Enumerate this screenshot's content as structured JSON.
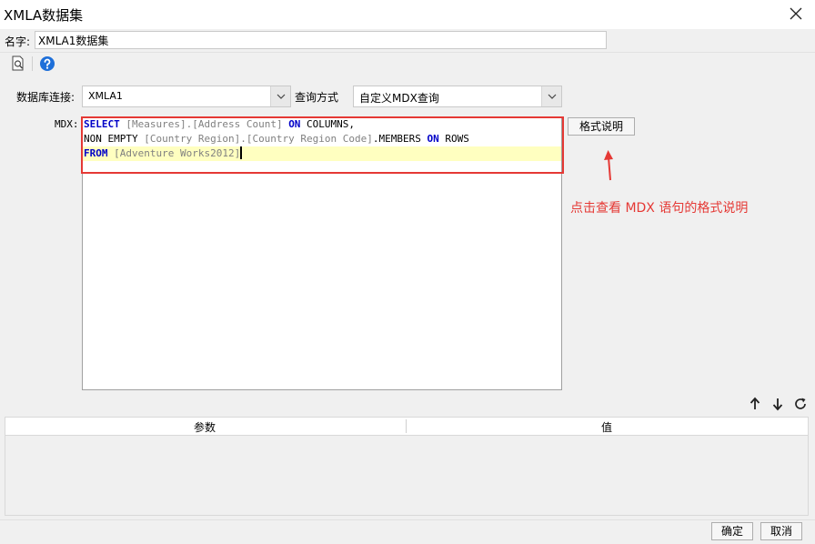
{
  "window": {
    "title": "XMLA数据集"
  },
  "name_field": {
    "label": "名字:",
    "value": "XMLA1数据集"
  },
  "connection": {
    "label": "数据库连接:",
    "value": "XMLA1"
  },
  "query_mode": {
    "label": "查询方式",
    "value": "自定义MDX查询"
  },
  "mdx": {
    "label": "MDX:",
    "lines": [
      [
        {
          "t": "SELECT",
          "c": "kw"
        },
        {
          "t": " ",
          "c": ""
        },
        {
          "t": "[Measures].[Address Count]",
          "c": "gr"
        },
        {
          "t": " ",
          "c": ""
        },
        {
          "t": "ON",
          "c": "kw"
        },
        {
          "t": " COLUMNS,",
          "c": ""
        }
      ],
      [
        {
          "t": "NON EMPTY ",
          "c": ""
        },
        {
          "t": "[Country Region].[Country Region Code]",
          "c": "gr"
        },
        {
          "t": ".MEMBERS ",
          "c": ""
        },
        {
          "t": "ON",
          "c": "kw"
        },
        {
          "t": " ROWS",
          "c": ""
        }
      ],
      [
        {
          "t": "FROM",
          "c": "kw"
        },
        {
          "t": " ",
          "c": ""
        },
        {
          "t": "[Adventure Works2012]",
          "c": "gr"
        }
      ]
    ]
  },
  "format_help_button": "格式说明",
  "annotation": "点击查看 MDX 语句的格式说明",
  "params_table": {
    "columns": [
      "参数",
      "值"
    ]
  },
  "footer": {
    "ok": "确定",
    "cancel": "取消"
  },
  "icons": {
    "preview": "preview-icon",
    "help": "help-icon",
    "up": "arrow-up-icon",
    "down": "arrow-down-icon",
    "refresh": "refresh-icon"
  },
  "colors": {
    "keyword": "#0000c8",
    "annotation": "#e53935",
    "help_icon": "#1e6fd9"
  }
}
